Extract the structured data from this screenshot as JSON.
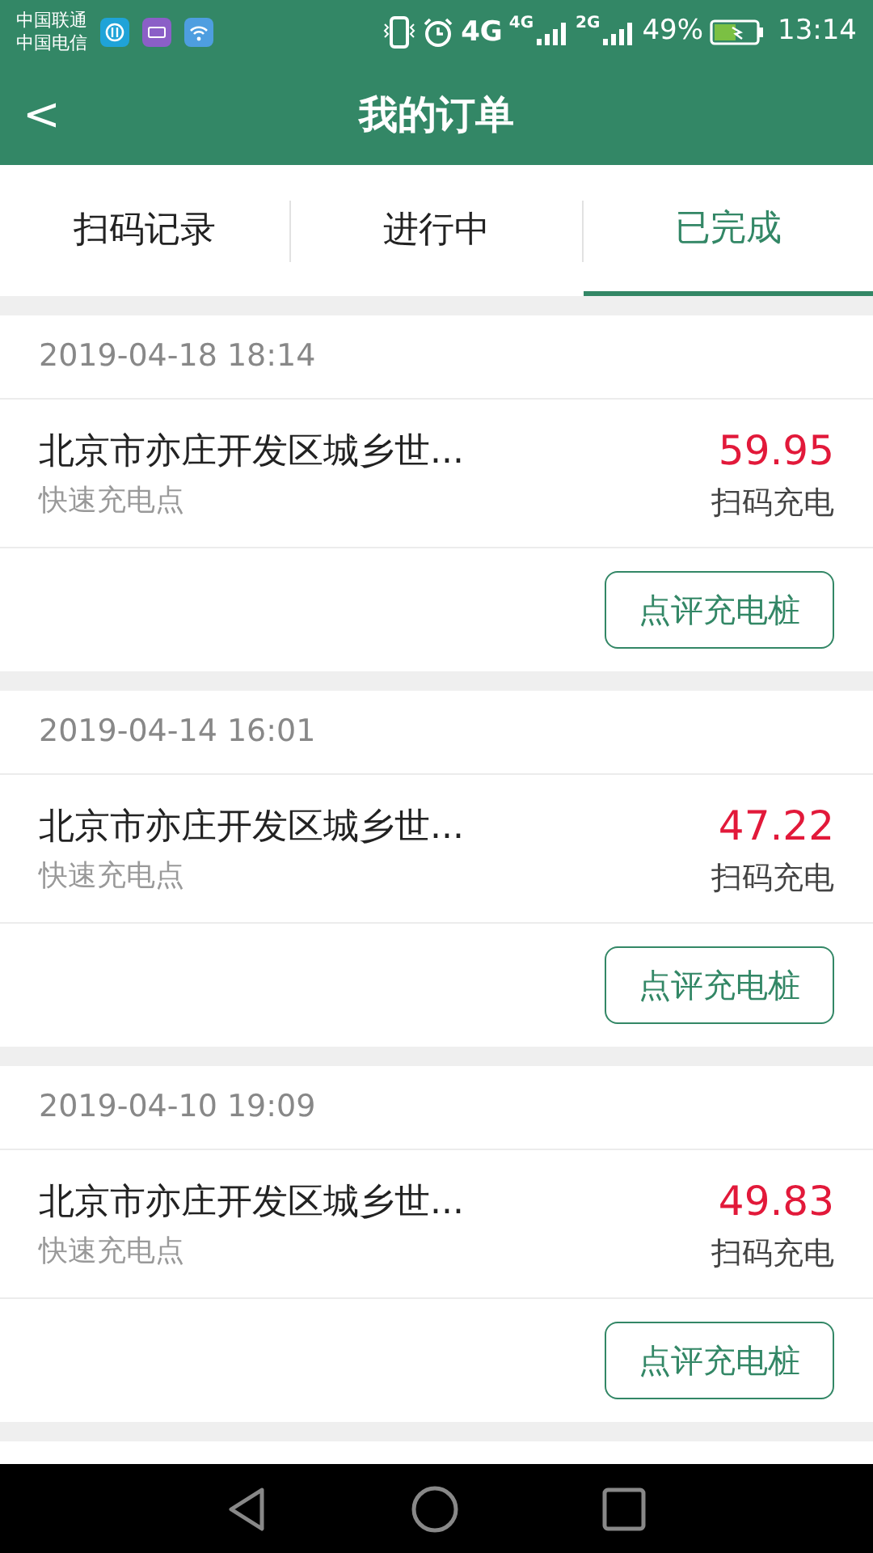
{
  "status_bar": {
    "carriers": [
      "中国联通",
      "中国电信"
    ],
    "network_labels": [
      "4G",
      "4G",
      "2G"
    ],
    "battery": "49%",
    "time": "13:14"
  },
  "header": {
    "back": "<",
    "title": "我的订单"
  },
  "tabs": [
    {
      "label": "扫码记录",
      "selected": false
    },
    {
      "label": "进行中",
      "selected": false
    },
    {
      "label": "已完成",
      "selected": true
    }
  ],
  "orders": [
    {
      "time": "2019-04-18 18:14",
      "station": "北京市亦庄开发区城乡世...",
      "type": "快速充电点",
      "amount": "59.95",
      "method": "扫码充电",
      "action": "点评充电桩"
    },
    {
      "time": "2019-04-14 16:01",
      "station": "北京市亦庄开发区城乡世...",
      "type": "快速充电点",
      "amount": "47.22",
      "method": "扫码充电",
      "action": "点评充电桩"
    },
    {
      "time": "2019-04-10 19:09",
      "station": "北京市亦庄开发区城乡世...",
      "type": "快速充电点",
      "amount": "49.83",
      "method": "扫码充电",
      "action": "点评充电桩"
    }
  ]
}
